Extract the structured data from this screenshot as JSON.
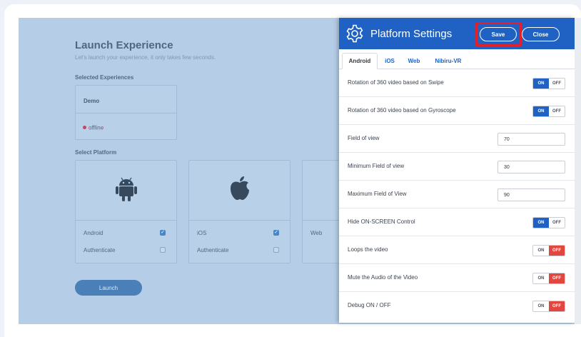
{
  "background": {
    "title": "Launch Experience",
    "subtitle": "Let's launch your experience, it only takes few seconds.",
    "selected_experiences_label": "Selected Experiences",
    "experience": {
      "name": "Demo",
      "status": "offline"
    },
    "select_platform_label": "Select Platform",
    "platforms": [
      {
        "name": "Android",
        "checked": true,
        "authenticate_label": "Authenticate",
        "authenticate_checked": false
      },
      {
        "name": "iOS",
        "checked": true,
        "authenticate_label": "Authenticate",
        "authenticate_checked": false
      },
      {
        "name": "Web"
      }
    ],
    "launch_label": "Launch"
  },
  "panel": {
    "title": "Platform Settings",
    "save_label": "Save",
    "close_label": "Close",
    "tabs": [
      "Android",
      "iOS",
      "Web",
      "Nibiru-VR"
    ],
    "active_tab": "Android",
    "toggle_on_label": "ON",
    "toggle_off_label": "OFF",
    "settings": [
      {
        "label": "Rotation of 360 video based on Swipe",
        "type": "toggle",
        "value": "ON"
      },
      {
        "label": "Rotation of 360 video based on Gyroscope",
        "type": "toggle",
        "value": "ON"
      },
      {
        "label": "Field of view",
        "type": "number",
        "value": "70"
      },
      {
        "label": "Minimum Field of view",
        "type": "number",
        "value": "30"
      },
      {
        "label": "Maximum Field of View",
        "type": "number",
        "value": "90"
      },
      {
        "label": "Hide ON-SCREEN Control",
        "type": "toggle",
        "value": "ON"
      },
      {
        "label": "Loops the video",
        "type": "toggle",
        "value": "OFF"
      },
      {
        "label": "Mute the Audio of the Video",
        "type": "toggle",
        "value": "OFF"
      },
      {
        "label": "Debug ON / OFF",
        "type": "toggle",
        "value": "OFF"
      }
    ]
  },
  "colors": {
    "primary": "#1f62c3",
    "off_active": "#e2473f",
    "highlight": "#e0202a",
    "overlay_bg": "#b5cde6"
  },
  "icons": {
    "panel_header": "gear-icon",
    "platform_android": "android-icon",
    "platform_ios": "apple-icon"
  }
}
